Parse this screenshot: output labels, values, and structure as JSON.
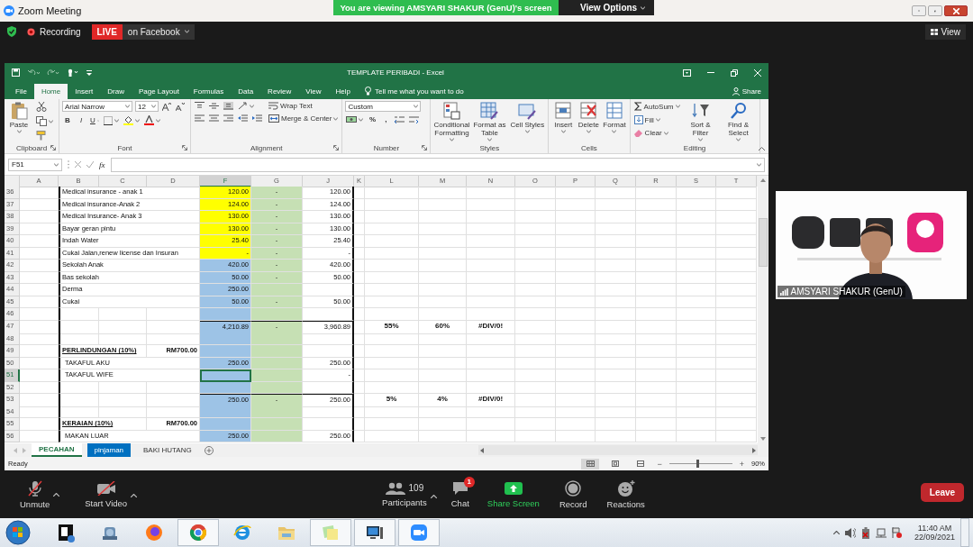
{
  "meeting": {
    "title": "Zoom Meeting",
    "banner": "You are viewing AMSYARI SHAKUR (GenU)'s screen",
    "view_options": "View Options",
    "recording": "Recording",
    "live": "LIVE",
    "stream": "on Facebook",
    "view": "View"
  },
  "excel": {
    "title": "TEMPLATE PERIBADI  -  Excel",
    "menu_tabs": [
      {
        "label": "File",
        "selected": false
      },
      {
        "label": "Home",
        "selected": true
      },
      {
        "label": "Insert",
        "selected": false
      },
      {
        "label": "Draw",
        "selected": false
      },
      {
        "label": "Page Layout",
        "selected": false
      },
      {
        "label": "Formulas",
        "selected": false
      },
      {
        "label": "Data",
        "selected": false
      },
      {
        "label": "Review",
        "selected": false
      },
      {
        "label": "View",
        "selected": false
      },
      {
        "label": "Help",
        "selected": false
      }
    ],
    "tell_me": "Tell me what you want to do",
    "share": "Share",
    "ribbon": [
      {
        "label": "Clipboard",
        "launcher": true,
        "columns": [
          [
            [
              {
                "kind": "paste",
                "label": "Paste"
              }
            ]
          ],
          [
            [
              {
                "kind": "cut"
              }
            ],
            [
              {
                "kind": "copy"
              }
            ],
            [
              {
                "kind": "format-painter"
              }
            ]
          ]
        ]
      },
      {
        "label": "Font",
        "launcher": true,
        "columns": [
          [
            [
              {
                "kind": "font-name",
                "value": "Arial Narrow"
              },
              {
                "kind": "font-size",
                "value": "12"
              },
              {
                "kind": "grow-font"
              },
              {
                "kind": "shrink-font"
              }
            ],
            [
              {
                "kind": "bold",
                "label": "B"
              },
              {
                "kind": "italic",
                "label": "I"
              },
              {
                "kind": "underline",
                "label": "U"
              },
              {
                "kind": "borders"
              },
              {
                "kind": "fill-color"
              },
              {
                "kind": "font-color"
              }
            ]
          ]
        ]
      },
      {
        "label": "Alignment",
        "launcher": true,
        "columns": [
          [
            [
              {
                "kind": "top-align"
              },
              {
                "kind": "middle-align"
              },
              {
                "kind": "bottom-align"
              },
              {
                "kind": "orientation"
              }
            ],
            [
              {
                "kind": "align-left"
              },
              {
                "kind": "align-center"
              },
              {
                "kind": "align-right"
              },
              {
                "kind": "outdent"
              },
              {
                "kind": "indent"
              }
            ]
          ],
          [
            [
              {
                "kind": "wrap-text",
                "label": "Wrap Text"
              }
            ],
            [
              {
                "kind": "merge",
                "label": "Merge & Center"
              }
            ]
          ]
        ]
      },
      {
        "label": "Number",
        "launcher": true,
        "columns": [
          [
            [
              {
                "kind": "number-format",
                "value": "Custom"
              }
            ],
            [
              {
                "kind": "accounting"
              },
              {
                "kind": "percent",
                "label": "%"
              },
              {
                "kind": "comma",
                "label": ","
              },
              {
                "kind": "inc-decimal"
              },
              {
                "kind": "dec-decimal"
              }
            ]
          ]
        ]
      },
      {
        "label": "Styles",
        "launcher": false,
        "columns": [
          [
            [
              {
                "kind": "conditional",
                "label": "Conditional Formatting"
              }
            ]
          ],
          [
            [
              {
                "kind": "format-table",
                "label": "Format as Table"
              }
            ]
          ],
          [
            [
              {
                "kind": "cell-styles",
                "label": "Cell Styles"
              }
            ]
          ]
        ]
      },
      {
        "label": "Cells",
        "launcher": false,
        "columns": [
          [
            [
              {
                "kind": "insert",
                "label": "Insert"
              }
            ]
          ],
          [
            [
              {
                "kind": "delete",
                "label": "Delete"
              }
            ]
          ],
          [
            [
              {
                "kind": "format",
                "label": "Format"
              }
            ]
          ]
        ]
      },
      {
        "label": "Editing",
        "launcher": false,
        "columns": [
          [
            [
              {
                "kind": "autosum",
                "label": "AutoSum"
              }
            ],
            [
              {
                "kind": "fill",
                "label": "Fill"
              }
            ],
            [
              {
                "kind": "clear",
                "label": "Clear"
              }
            ]
          ],
          [
            [
              {
                "kind": "sort",
                "label": "Sort & Filter"
              }
            ]
          ],
          [
            [
              {
                "kind": "find",
                "label": "Find & Select"
              }
            ]
          ]
        ]
      }
    ],
    "name_box": "F51",
    "function_label": "fx",
    "columns": [
      {
        "label": "A",
        "selected": false
      },
      {
        "label": "B",
        "selected": false
      },
      {
        "label": "C",
        "selected": false
      },
      {
        "label": "D",
        "selected": false
      },
      {
        "label": "F",
        "selected": true
      },
      {
        "label": "G",
        "selected": false
      },
      {
        "label": "J",
        "selected": false
      },
      {
        "label": "K",
        "selected": false
      },
      {
        "label": "L",
        "selected": false
      },
      {
        "label": "M",
        "selected": false
      },
      {
        "label": "N",
        "selected": false
      },
      {
        "label": "O",
        "selected": false
      },
      {
        "label": "P",
        "selected": false
      },
      {
        "label": "Q",
        "selected": false
      },
      {
        "label": "R",
        "selected": false
      },
      {
        "label": "S",
        "selected": false
      },
      {
        "label": "T",
        "selected": false
      }
    ],
    "rows": [
      {
        "number": "36",
        "kind": "item",
        "selected": false,
        "color": "#ffff00",
        "b": "Medical insurance - anak 1",
        "f": "120.00",
        "g": "-",
        "j": "120.00"
      },
      {
        "number": "37",
        "kind": "item",
        "selected": false,
        "color": "#ffff00",
        "b": "Medical insurance-Anak 2",
        "f": "124.00",
        "g": "-",
        "j": "124.00"
      },
      {
        "number": "38",
        "kind": "item",
        "selected": false,
        "color": "#ffff00",
        "b": "Medical Insurance- Anak 3",
        "f": "130.00",
        "g": "-",
        "j": "130.00"
      },
      {
        "number": "39",
        "kind": "item",
        "selected": false,
        "color": "#ffff00",
        "b": "Bayar geran pintu",
        "f": "130.00",
        "g": "-",
        "j": "130.00"
      },
      {
        "number": "40",
        "kind": "item",
        "selected": false,
        "color": "#ffff00",
        "b": "Indah Water",
        "f": "25.40",
        "g": "-",
        "j": "25.40"
      },
      {
        "number": "41",
        "kind": "item",
        "selected": false,
        "color": "#ffff00",
        "b": "Cukai Jalan,renew license dan Insuran",
        "f": "-",
        "g": "-",
        "j": "-"
      },
      {
        "number": "42",
        "kind": "item",
        "selected": false,
        "color": "#9dc3e6",
        "b": "Sekolah Anak",
        "f": "420.00",
        "g": "-",
        "j": "420.00"
      },
      {
        "number": "43",
        "kind": "item",
        "selected": false,
        "color": "#9dc3e6",
        "b": "Bas sekolah",
        "f": "50.00",
        "g": "-",
        "j": "50.00"
      },
      {
        "number": "44",
        "kind": "item",
        "selected": false,
        "color": "#9dc3e6",
        "b": "Derma",
        "f": "250.00"
      },
      {
        "number": "45",
        "kind": "item",
        "selected": false,
        "color": "#9dc3e6",
        "b": "Cukai",
        "f": "50.00",
        "g": "-",
        "j": "50.00"
      },
      {
        "number": "46",
        "kind": "blank",
        "selected": false,
        "color": "#9dc3e6"
      },
      {
        "number": "47",
        "kind": "total",
        "selected": false,
        "color": "#9dc3e6",
        "f": "4,210.89",
        "g": "-",
        "j": "3,960.89",
        "l": "55%",
        "m": "60%",
        "n": "#DIV/0!"
      },
      {
        "number": "48",
        "kind": "blank",
        "selected": false,
        "color": "#9dc3e6"
      },
      {
        "number": "49",
        "kind": "heading",
        "selected": false,
        "color": "#9dc3e6",
        "b": "PERLINDUNGAN (10%)",
        "d": "RM700.00"
      },
      {
        "number": "50",
        "kind": "item",
        "selected": false,
        "color": "#9dc3e6",
        "b": "TAKAFUL AKU",
        "f": "250.00",
        "j": "250.00"
      },
      {
        "number": "51",
        "kind": "item",
        "selected": true,
        "color": "#9dc3e6",
        "b": "TAKAFUL WIFE",
        "j": "-"
      },
      {
        "number": "52",
        "kind": "blank",
        "selected": false,
        "color": "#9dc3e6"
      },
      {
        "number": "53",
        "kind": "total",
        "selected": false,
        "color": "#9dc3e6",
        "f": "250.00",
        "g": "-",
        "j": "250.00",
        "l": "5%",
        "m": "4%",
        "n": "#DIV/0!"
      },
      {
        "number": "54",
        "kind": "blank",
        "selected": false,
        "color": "#9dc3e6"
      },
      {
        "number": "55",
        "kind": "heading",
        "selected": false,
        "color": "#9dc3e6",
        "b": "KERAIAN (10%)",
        "d": "RM700.00"
      },
      {
        "number": "56",
        "kind": "item",
        "selected": false,
        "color": "#9dc3e6",
        "b": "MAKAN LUAR",
        "f": "250.00",
        "j": "250.00"
      }
    ],
    "sheets": [
      {
        "label": "PECAHAN",
        "selected": true
      },
      {
        "label": "pinjaman",
        "selected": false,
        "color": "#0070c0"
      },
      {
        "label": "BAKI HUTANG",
        "selected": false
      }
    ],
    "status": "Ready",
    "zoom": {
      "minus": "−",
      "level": 0.45,
      "plus": "+",
      "reading": "90%"
    }
  },
  "video": {
    "name": "AMSYARI SHAKUR (GenU)"
  },
  "toolbar": {
    "controls": [
      {
        "kind": "mic-muted",
        "label": "Unmute",
        "menu": true
      },
      {
        "kind": "video-off",
        "label": "Start Video",
        "menu": true
      },
      {
        "kind": "participants",
        "label": "Participants",
        "count": "109",
        "menu": true
      },
      {
        "kind": "chat",
        "label": "Chat",
        "badge": "1",
        "menu": false
      },
      {
        "kind": "share",
        "label": "Share Screen",
        "menu": false
      },
      {
        "kind": "record",
        "label": "Record",
        "menu": false
      },
      {
        "kind": "reactions",
        "label": "Reactions",
        "menu": false
      }
    ],
    "leave": "Leave"
  },
  "taskbar": {
    "apps": [
      {
        "kind": "document",
        "running": false
      },
      {
        "kind": "robot",
        "running": false
      },
      {
        "kind": "fox",
        "running": false
      },
      {
        "kind": "wheel",
        "running": true
      },
      {
        "kind": "letter-e",
        "running": false
      },
      {
        "kind": "folder",
        "running": false
      },
      {
        "kind": "notes",
        "running": true
      },
      {
        "kind": "computer",
        "running": true
      },
      {
        "kind": "camera",
        "running": true
      }
    ],
    "time": "11:40 AM",
    "date": "22/09/2021"
  }
}
